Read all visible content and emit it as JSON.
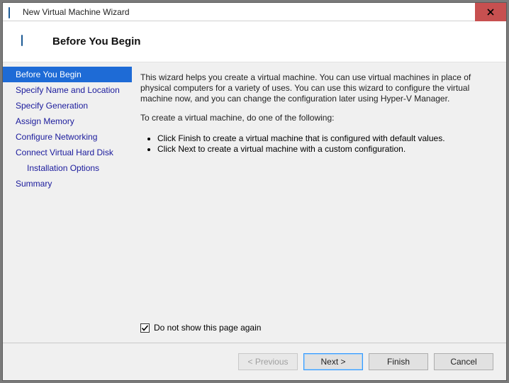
{
  "titlebar": {
    "title": "New Virtual Machine Wizard"
  },
  "banner": {
    "title": "Before You Begin"
  },
  "sidebar": {
    "items": [
      {
        "label": "Before You Begin"
      },
      {
        "label": "Specify Name and Location"
      },
      {
        "label": "Specify Generation"
      },
      {
        "label": "Assign Memory"
      },
      {
        "label": "Configure Networking"
      },
      {
        "label": "Connect Virtual Hard Disk"
      },
      {
        "label": "Installation Options"
      },
      {
        "label": "Summary"
      }
    ]
  },
  "content": {
    "paragraph1": "This wizard helps you create a virtual machine. You can use virtual machines in place of physical computers for a variety of uses. You can use this wizard to configure the virtual machine now, and you can change the configuration later using Hyper-V Manager.",
    "paragraph2": "To create a virtual machine, do one of the following:",
    "bullet1": "Click Finish to create a virtual machine that is configured with default values.",
    "bullet2": "Click Next to create a virtual machine with a custom configuration.",
    "checkbox_label": "Do not show this page again"
  },
  "footer": {
    "previous": "< Previous",
    "next": "Next >",
    "finish": "Finish",
    "cancel": "Cancel"
  }
}
